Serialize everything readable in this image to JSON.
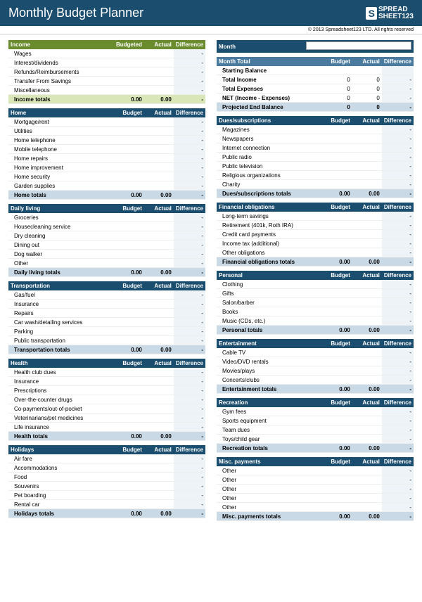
{
  "title": "Monthly Budget Planner",
  "logo": {
    "box": "S",
    "line1": "SPREAD",
    "line2": "SHEET",
    "num": "123"
  },
  "copyright": "© 2013 Spreadsheet123 LTD. All rights reserved",
  "cols": {
    "budget": "Budget",
    "budgeted": "Budgeted",
    "actual": "Actual",
    "difference": "Difference"
  },
  "dash": "-",
  "zero": "0",
  "zero2": "0.00",
  "month_label": "Month",
  "summary": {
    "header": "Month Total",
    "start": "Starting Balance",
    "income": "Total Income",
    "expenses": "Total Expenses",
    "net": "NET (Income - Expenses)",
    "projected": "Projected End Balance"
  },
  "left_sections": [
    {
      "title": "Income",
      "green": true,
      "items": [
        "Wages",
        "Interest/dividends",
        "Refunds/Reimbursements",
        "Transfer From Savings",
        "Miscellaneous"
      ],
      "totals": "Income totals"
    },
    {
      "title": "Home",
      "items": [
        "Mortgage/rent",
        "Utilities",
        "Home telephone",
        "Mobile telephone",
        "Home repairs",
        "Home improvement",
        "Home security",
        "Garden supplies"
      ],
      "totals": "Home totals"
    },
    {
      "title": "Daily living",
      "items": [
        "Groceries",
        "Housecleaning service",
        "Dry cleaning",
        "Dining out",
        "Dog walker",
        "Other"
      ],
      "totals": "Daily living totals"
    },
    {
      "title": "Transportation",
      "items": [
        "Gas/fuel",
        "Insurance",
        "Repairs",
        "Car wash/detailing services",
        "Parking",
        "Public transportation"
      ],
      "totals": "Transportation totals"
    },
    {
      "title": "Health",
      "items": [
        "Health club dues",
        "Insurance",
        "Prescriptions",
        "Over-the-counter drugs",
        "Co-payments/out-of-pocket",
        "Veterinarians/pet medicines",
        "Life insurance"
      ],
      "totals": "Health totals"
    },
    {
      "title": "Holidays",
      "items": [
        "Air fare",
        "Accommodations",
        "Food",
        "Souvenirs",
        "Pet boarding",
        "Rental car"
      ],
      "totals": "Holidays totals"
    }
  ],
  "right_sections": [
    {
      "title": "Dues/subscriptions",
      "items": [
        "Magazines",
        "Newspapers",
        "Internet connection",
        "Public radio",
        "Public television",
        "Religious organizations",
        "Charity"
      ],
      "totals": "Dues/subscriptions totals"
    },
    {
      "title": "Financial obligations",
      "items": [
        "Long-term savings",
        "Retirement (401k, Roth IRA)",
        "Credit card payments",
        "Income tax (additional)",
        "Other obligations"
      ],
      "totals": "Financial obligations totals"
    },
    {
      "title": "Personal",
      "items": [
        "Clothing",
        "Gifts",
        "Salon/barber",
        "Books",
        "Music (CDs, etc.)"
      ],
      "totals": "Personal totals"
    },
    {
      "title": "Entertainment",
      "items": [
        "Cable TV",
        "Video/DVD rentals",
        "Movies/plays",
        "Concerts/clubs"
      ],
      "totals": "Entertainment totals"
    },
    {
      "title": "Recreation",
      "items": [
        "Gym fees",
        "Sports equipment",
        "Team dues",
        "Toys/child gear"
      ],
      "totals": "Recreation totals"
    },
    {
      "title": "Misc. payments",
      "items": [
        "Other",
        "Other",
        "Other",
        "Other",
        "Other"
      ],
      "totals": "Misc. payments totals"
    }
  ]
}
